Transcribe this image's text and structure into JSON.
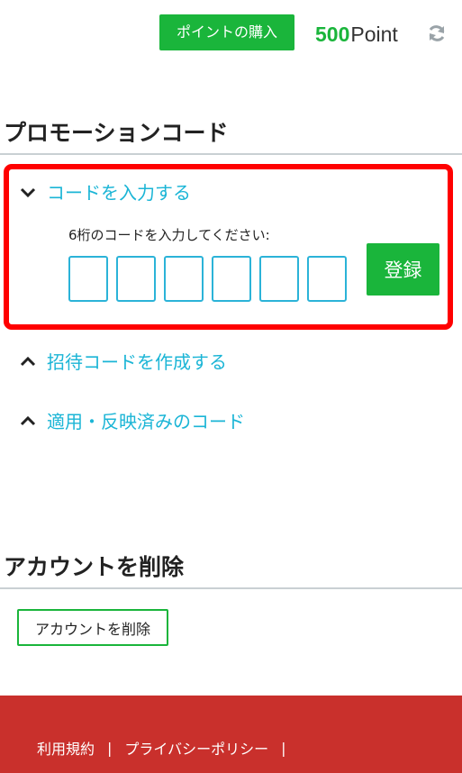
{
  "header": {
    "buy_points_label": "ポイントの購入",
    "points_value": "500",
    "points_unit": "Point",
    "refresh_icon": "refresh-icon"
  },
  "promo": {
    "title": "プロモーションコード",
    "enter_code": {
      "label": "コードを入力する",
      "expanded": true,
      "prompt": "6桁のコードを入力してください:",
      "digit_values": [
        "",
        "",
        "",
        "",
        "",
        ""
      ],
      "register_label": "登録"
    },
    "invite_code": {
      "label": "招待コードを作成する",
      "expanded": false
    },
    "applied_codes": {
      "label": "適用・反映済みのコード",
      "expanded": false
    }
  },
  "account": {
    "title": "アカウントを削除",
    "delete_label": "アカウントを削除"
  },
  "footer": {
    "terms_label": "利用規約",
    "privacy_label": "プライバシーポリシー",
    "separator": "|"
  },
  "colors": {
    "accent_green": "#1ab53b",
    "link_cyan": "#1bb5d6",
    "highlight_red": "#ff0000",
    "footer_red": "#c9302c"
  }
}
